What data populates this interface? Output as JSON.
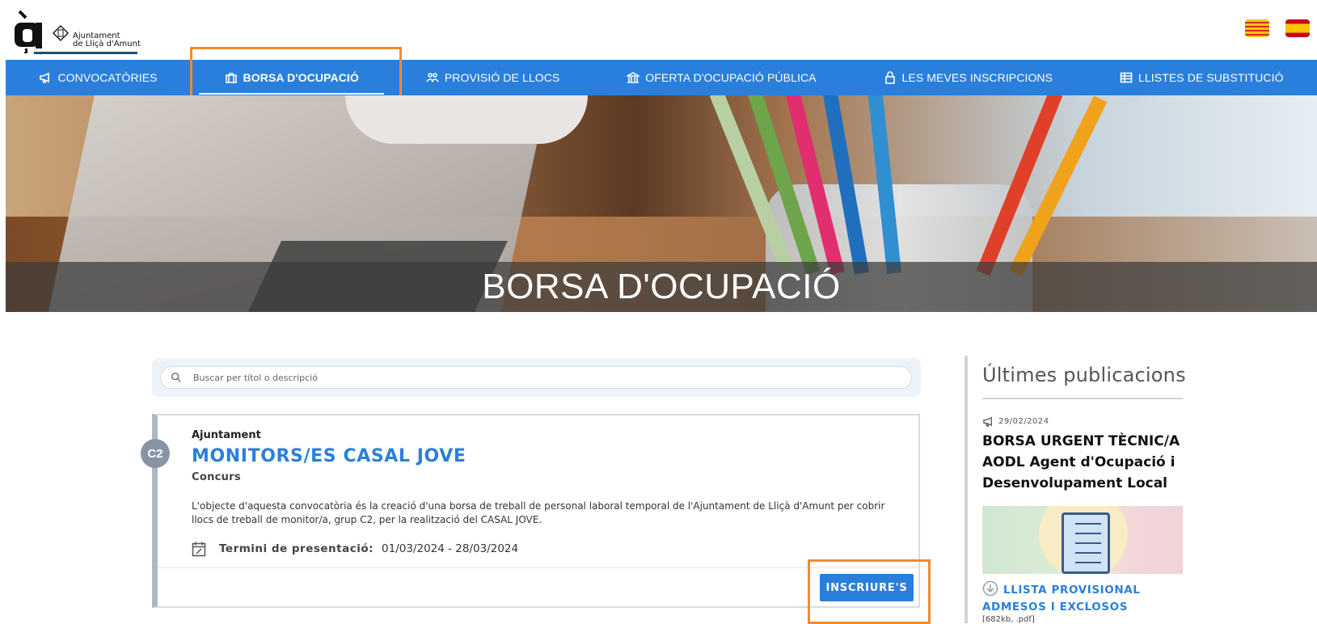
{
  "header": {
    "logo_text_line1": "Ajuntament",
    "logo_text_line2": "de Lliçà d'Amunt",
    "languages": [
      "Català",
      "Español"
    ]
  },
  "nav": {
    "items": [
      {
        "label": "CONVOCATÒRIES",
        "icon": "megaphone-icon"
      },
      {
        "label": "BORSA D'OCUPACIÓ",
        "icon": "briefcase-icon",
        "active": true
      },
      {
        "label": "PROVISIÓ DE LLOCS",
        "icon": "people-icon"
      },
      {
        "label": "OFERTA D'OCUPACIÓ PÚBLICA",
        "icon": "institution-icon"
      },
      {
        "label": "LES MEVES INSCRIPCIONS",
        "icon": "lock-icon"
      },
      {
        "label": "LLISTES DE SUBSTITUCIÓ",
        "icon": "table-icon"
      }
    ]
  },
  "hero": {
    "title": "BORSA D'OCUPACIÓ"
  },
  "search": {
    "placeholder": "Buscar per títol o descripció"
  },
  "offer": {
    "badge": "C2",
    "organization": "Ajuntament",
    "title": "MONITORS/ES CASAL JOVE",
    "type": "Concurs",
    "description": "L'objecte d'aquesta convocatòria és la creació d'una borsa de treball de personal laboral temporal de l'Ajuntament de Lliçà d'Amunt per cobrir llocs de treball de monitor/a, grup C2, per la realització del CASAL JOVE.",
    "term_label": "Termini de presentació:",
    "term_value": "01/03/2024 - 28/03/2024",
    "button_label": "INSCRIURE'S"
  },
  "sidebar": {
    "heading": "Últimes publicacions",
    "pub_date": "29/02/2024",
    "pub_title": "BORSA URGENT TÈCNIC/A AODL Agent d'Ocupació i Desenvolupament Local",
    "download_label": "LLISTA PROVISIONAL ADMESOS I EXCLOSOS",
    "file_info": "[682kb, .pdf]"
  },
  "colors": {
    "brand_blue": "#2a7fdc",
    "highlight_orange": "#f28a2e"
  }
}
